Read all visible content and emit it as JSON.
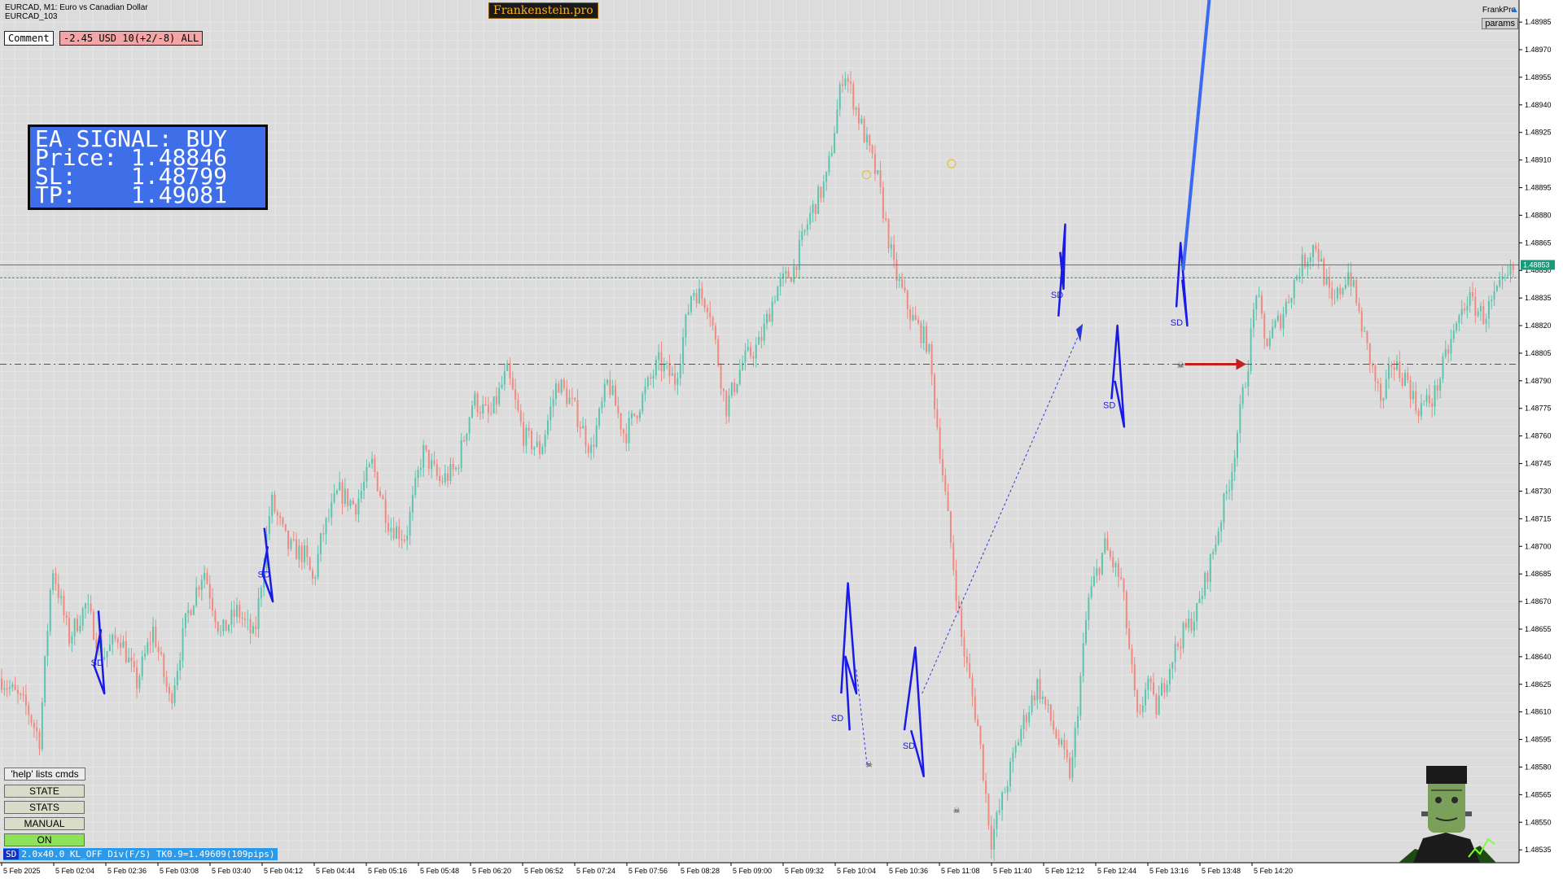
{
  "window": {
    "symbol_line": "EURCAD, M1:  Euro vs Canadian Dollar",
    "account_line": "EURCAD_103",
    "brand": "Frankenstein.pro",
    "top_right_label": "FrankPro",
    "top_right_icon": "graduation-cap-icon",
    "params_button": "params"
  },
  "toolbar": {
    "comment_label": "Comment",
    "pnl_text": "-2.45 USD 10(+2/-8) ALL"
  },
  "signal": {
    "line1": "EA SIGNAL: BUY",
    "line2": "Price: 1.48846",
    "line3": "SL:    1.48799",
    "line4": "TP:    1.49081"
  },
  "panel": {
    "help": "'help' lists cmds",
    "state": "STATE",
    "stats": "STATS",
    "manual": "MANUAL",
    "on": "ON"
  },
  "status_bar": {
    "tag": "SD",
    "text": "2.0x40.0 KL_OFF Div(F/S) TK0.9=1.49609(109pips)"
  },
  "colors": {
    "background": "#dcdcdc",
    "bull": "#5cc4ae",
    "bear": "#ef8a80",
    "price_line": "#1a9a7a",
    "sl_line": "#d42020",
    "sd_pattern": "#1a1ae6",
    "signal_box": "#3e6fe8"
  },
  "chart_data": {
    "type": "candlestick",
    "symbol": "EURCAD",
    "timeframe": "M1",
    "y_ticks": [
      1.48535,
      1.4855,
      1.48565,
      1.4858,
      1.48595,
      1.4861,
      1.48625,
      1.4864,
      1.48655,
      1.4867,
      1.48685,
      1.487,
      1.48715,
      1.4873,
      1.48745,
      1.4876,
      1.48775,
      1.4879,
      1.48805,
      1.4882,
      1.48835,
      1.4885,
      1.48865,
      1.4888,
      1.48895,
      1.4891,
      1.48925,
      1.4894,
      1.48955,
      1.4897,
      1.48985
    ],
    "y_tick_labels": [
      "1.48535",
      "1.48550",
      "1.48565",
      "1.48580",
      "1.48595",
      "1.48610",
      "1.48625",
      "1.48640",
      "1.48655",
      "1.48670",
      "1.48685",
      "1.48700",
      "1.48715",
      "1.48730",
      "1.48745",
      "1.48760",
      "1.48775",
      "1.48790",
      "1.48805",
      "1.48820",
      "1.48835",
      "1.48850",
      "1.48865",
      "1.48880",
      "1.48895",
      "1.48910",
      "1.48925",
      "1.48940",
      "1.48955",
      "1.48970",
      "1.48985"
    ],
    "ylim": [
      1.48528,
      1.48997
    ],
    "current_price_label": "1.48853",
    "current_price": 1.48853,
    "bid_line": 1.48846,
    "sl_level": 1.48799,
    "x_labels": [
      "5 Feb 2025",
      "5 Feb 02:04",
      "5 Feb 02:36",
      "5 Feb 03:08",
      "5 Feb 03:40",
      "5 Feb 04:12",
      "5 Feb 04:44",
      "5 Feb 05:16",
      "5 Feb 05:48",
      "5 Feb 06:20",
      "5 Feb 06:52",
      "5 Feb 07:24",
      "5 Feb 07:56",
      "5 Feb 08:28",
      "5 Feb 09:00",
      "5 Feb 09:32",
      "5 Feb 10:04",
      "5 Feb 10:36",
      "5 Feb 11:08",
      "5 Feb 11:40",
      "5 Feb 12:12",
      "5 Feb 12:44",
      "5 Feb 13:16",
      "5 Feb 13:48",
      "5 Feb 14:20"
    ],
    "price_path": [
      [
        0,
        1.48628
      ],
      [
        3,
        1.48612
      ],
      [
        4.5,
        1.48595
      ],
      [
        6,
        1.4869
      ],
      [
        8,
        1.4865
      ],
      [
        10,
        1.48668
      ],
      [
        12,
        1.4864
      ],
      [
        14,
        1.48652
      ],
      [
        16,
        1.48625
      ],
      [
        18,
        1.48655
      ],
      [
        20,
        1.48615
      ],
      [
        22,
        1.48662
      ],
      [
        24,
        1.48688
      ],
      [
        26,
        1.48652
      ],
      [
        28,
        1.48665
      ],
      [
        30,
        1.4865
      ],
      [
        32,
        1.48725
      ],
      [
        34,
        1.487
      ],
      [
        36,
        1.48695
      ],
      [
        37,
        1.4868
      ],
      [
        38,
        1.48705
      ],
      [
        40,
        1.4873
      ],
      [
        42,
        1.48722
      ],
      [
        44,
        1.48745
      ],
      [
        46,
        1.48712
      ],
      [
        48,
        1.48705
      ],
      [
        50,
        1.48752
      ],
      [
        52,
        1.48735
      ],
      [
        54,
        1.48742
      ],
      [
        56,
        1.4878
      ],
      [
        58,
        1.4877
      ],
      [
        60,
        1.48795
      ],
      [
        62,
        1.4876
      ],
      [
        64,
        1.48752
      ],
      [
        66,
        1.4879
      ],
      [
        68,
        1.48775
      ],
      [
        70,
        1.48752
      ],
      [
        72,
        1.4879
      ],
      [
        74,
        1.4876
      ],
      [
        76,
        1.4878
      ],
      [
        78,
        1.488
      ],
      [
        80,
        1.4879
      ],
      [
        82,
        1.4884
      ],
      [
        84,
        1.48832
      ],
      [
        86,
        1.48775
      ],
      [
        88,
        1.488
      ],
      [
        90,
        1.4881
      ],
      [
        92,
        1.4884
      ],
      [
        94,
        1.4885
      ],
      [
        96,
        1.4888
      ],
      [
        98,
        1.489
      ],
      [
        100,
        1.4896
      ],
      [
        102,
        1.4893
      ],
      [
        104,
        1.489
      ],
      [
        106,
        1.4885
      ],
      [
        108,
        1.48825
      ],
      [
        110,
        1.4881
      ],
      [
        112,
        1.4873
      ],
      [
        114,
        1.4865
      ],
      [
        116,
        1.486
      ],
      [
        117.5,
        1.4854
      ],
      [
        119,
        1.48565
      ],
      [
        121,
        1.486
      ],
      [
        123,
        1.48625
      ],
      [
        125,
        1.486
      ],
      [
        127,
        1.48575
      ],
      [
        129,
        1.4867
      ],
      [
        131,
        1.487
      ],
      [
        133,
        1.4868
      ],
      [
        135,
        1.486
      ],
      [
        136,
        1.4863
      ],
      [
        137,
        1.4861
      ],
      [
        139,
        1.4864
      ],
      [
        140,
        1.4865
      ],
      [
        142,
        1.48665
      ],
      [
        144,
        1.487
      ],
      [
        146,
        1.4874
      ],
      [
        148,
        1.488
      ],
      [
        149,
        1.4884
      ],
      [
        150,
        1.4881
      ],
      [
        152,
        1.48825
      ],
      [
        154,
        1.4885
      ],
      [
        156,
        1.48865
      ],
      [
        158,
        1.4883
      ],
      [
        160,
        1.4885
      ],
      [
        162,
        1.4881
      ],
      [
        164,
        1.48775
      ],
      [
        165,
        1.488
      ],
      [
        167,
        1.4879
      ],
      [
        168,
        1.48775
      ],
      [
        170,
        1.4878
      ],
      [
        172,
        1.4881
      ],
      [
        174,
        1.48835
      ],
      [
        176,
        1.48825
      ],
      [
        178,
        1.4884
      ],
      [
        179.5,
        1.4885
      ]
    ],
    "sd_patterns_label": "SD"
  }
}
